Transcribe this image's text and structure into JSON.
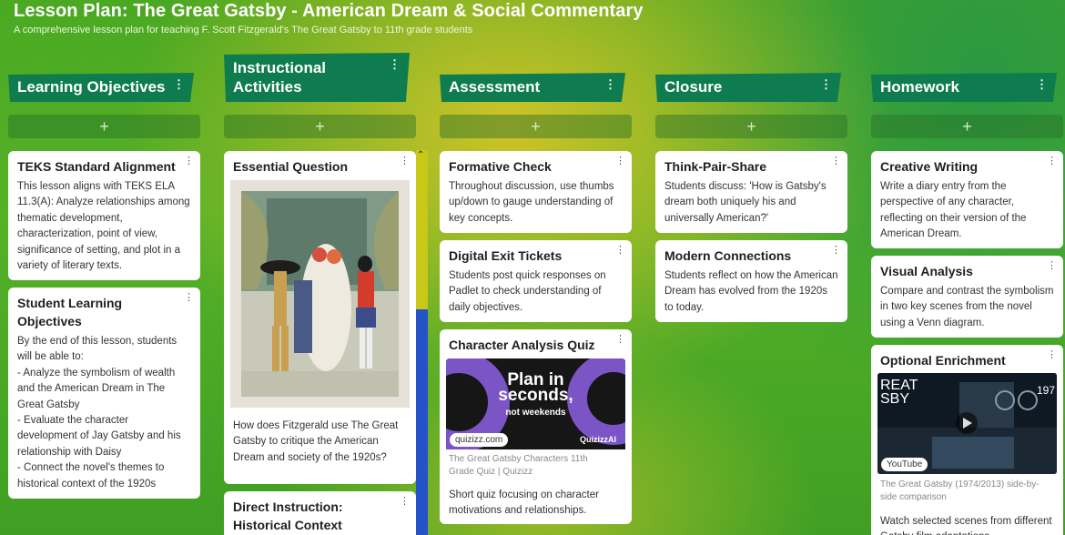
{
  "page": {
    "title": "Lesson Plan: The Great Gatsby - American Dream & Social Commentary",
    "subtitle": "A comprehensive lesson plan for teaching F. Scott Fitzgerald's The Great Gatsby to 11th grade students"
  },
  "ui": {
    "add_symbol": "+",
    "kebab_symbol": "⋮",
    "scroll_up_symbol": "⌃"
  },
  "columns": [
    {
      "title": "Learning Objectives",
      "cards": [
        {
          "title": "TEKS Standard Alignment",
          "body": "This lesson aligns with TEKS ELA 11.3(A): Analyze relationships among thematic development, characterization, point of view, significance of setting, and plot in a variety of literary texts."
        },
        {
          "title": "Student Learning Objectives",
          "body": "By the end of this lesson, students will be able to:\n- Analyze the symbolism of wealth and the American Dream in The Great Gatsby\n- Evaluate the character development of Jay Gatsby and his relationship with Daisy\n- Connect the novel's themes to historical context of the 1920s"
        }
      ]
    },
    {
      "title": "Instructional Activities",
      "cards": [
        {
          "title": "Essential Question",
          "body": "How does Fitzgerald use The Great Gatsby to critique the American Dream and society of the 1920s?"
        },
        {
          "title": "Direct Instruction: Historical Context",
          "body": ""
        }
      ]
    },
    {
      "title": "Assessment",
      "cards": [
        {
          "title": "Formative Check",
          "body": "Throughout discussion, use thumbs up/down to gauge understanding of key concepts."
        },
        {
          "title": "Digital Exit Tickets",
          "body": "Students post quick responses on Padlet to check understanding of daily objectives."
        },
        {
          "title": "Character Analysis Quiz",
          "image_heading_1": "Plan in",
          "image_heading_2": "seconds,",
          "image_tagline": "not weekends",
          "image_brand": "QuizizzAI",
          "source": "quizizz.com",
          "link_title": "The Great Gatsby Characters 11th Grade Quiz | Quizizz",
          "body": "Short quiz focusing on character motivations and relationships."
        }
      ]
    },
    {
      "title": "Closure",
      "cards": [
        {
          "title": "Think-Pair-Share",
          "body": "Students discuss: 'How is Gatsby's dream both uniquely his and universally American?'"
        },
        {
          "title": "Modern Connections",
          "body": "Students reflect on how the American Dream has evolved from the 1920s to today."
        }
      ]
    },
    {
      "title": "Homework",
      "cards": [
        {
          "title": "Creative Writing",
          "body": "Write a diary entry from the perspective of any character, reflecting on their version of the American Dream."
        },
        {
          "title": "Visual Analysis",
          "body": "Compare and contrast the symbolism in two key scenes from the novel using a Venn diagram."
        },
        {
          "title": "Optional Enrichment",
          "video_text_left": "REAT\nSBY",
          "video_text_right": "197",
          "source": "YouTube",
          "link_title": "The Great Gatsby (1974/2013) side-by-side comparison",
          "body": "Watch selected scenes from different Gatsby film adaptations"
        }
      ]
    }
  ]
}
